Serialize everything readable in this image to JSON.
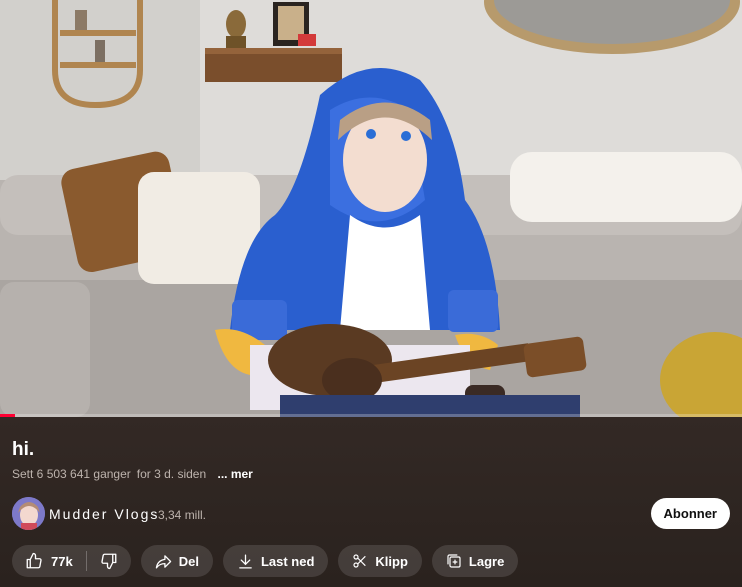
{
  "video": {
    "progress_fraction": 0.02,
    "colors": {
      "progress": "#ff0033"
    }
  },
  "info": {
    "title": "hi.",
    "views": "Sett 6 503 641 ganger",
    "age": "for 3 d. siden",
    "more_label": "... mer"
  },
  "channel": {
    "name": "Mudder Vlogs",
    "subscribers": "3,34 mill.",
    "subscribe_label": "Abonner"
  },
  "actions": {
    "like_count": "77k",
    "share_label": "Del",
    "download_label": "Last ned",
    "clip_label": "Klipp",
    "save_label": "Lagre"
  },
  "icons": [
    "thumb-up-icon",
    "thumb-down-icon",
    "share-icon",
    "download-icon",
    "scissors-icon",
    "save-playlist-icon"
  ]
}
